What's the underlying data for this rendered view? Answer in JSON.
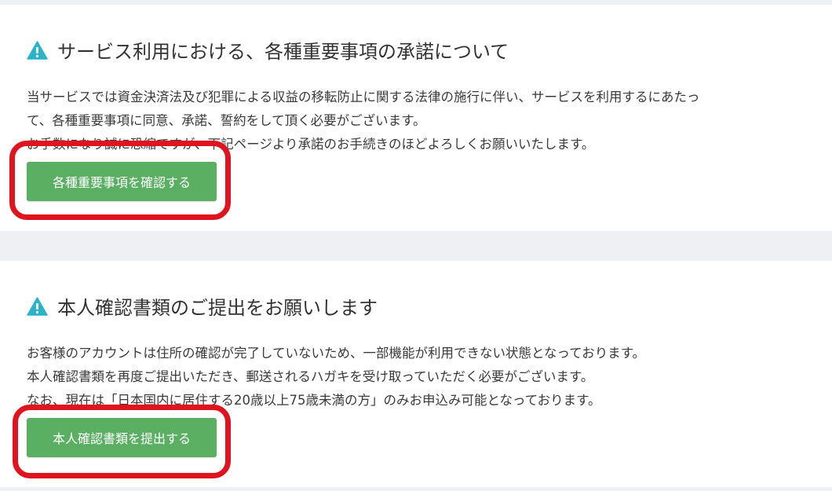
{
  "colors": {
    "button_green": "#5aaf63",
    "warning_icon": "#2bb3c8",
    "highlight_red": "#e0141e",
    "page_bg": "#eef0f4"
  },
  "consent_section": {
    "icon": "warning-triangle-icon",
    "title": "サービス利用における、各種重要事項の承諾について",
    "lines": [
      "当サービスでは資金決済法及び犯罪による収益の移転防止に関する法律の施行に伴い、サービスを利用するにあたっ",
      "て、各種重要事項に同意、承諾、誓約をして頂く必要がございます。",
      "お手数になり誠に恐縮ですが、下記ページより承諾のお手続きのほどよろしくお願いいたします。"
    ],
    "button_label": "各種重要事項を確認する"
  },
  "identity_section": {
    "icon": "warning-triangle-icon",
    "title": "本人確認書類のご提出をお願いします",
    "lines": [
      "お客様のアカウントは住所の確認が完了していないため、一部機能が利用できない状態となっております。",
      "本人確認書類を再度ご提出いただき、郵送されるハガキを受け取っていただく必要がございます。",
      "なお、現在は「日本国内に居住する20歳以上75歳未満の方」のみお申込み可能となっております。"
    ],
    "button_label": "本人確認書類を提出する"
  }
}
